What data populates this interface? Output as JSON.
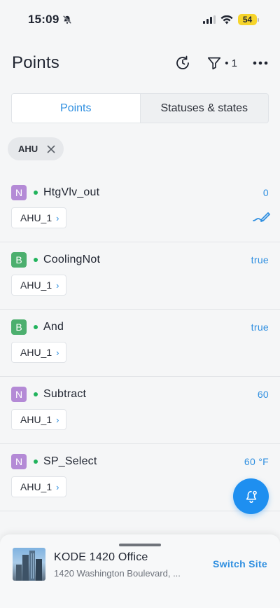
{
  "status_bar": {
    "time": "15:09",
    "battery": "54"
  },
  "header": {
    "title": "Points",
    "filter_count": "• 1"
  },
  "tabs": [
    {
      "label": "Points",
      "active": true
    },
    {
      "label": "Statuses & states",
      "active": false
    }
  ],
  "filter_chip": {
    "label": "AHU"
  },
  "points": [
    {
      "type": "N",
      "type_color": "#b48ad6",
      "name": "HtgVlv_out",
      "value": "0",
      "equipment": "AHU_1",
      "editable": true
    },
    {
      "type": "B",
      "type_color": "#4caf6e",
      "name": "CoolingNot",
      "value": "true",
      "equipment": "AHU_1",
      "editable": false
    },
    {
      "type": "B",
      "type_color": "#4caf6e",
      "name": "And",
      "value": "true",
      "equipment": "AHU_1",
      "editable": false
    },
    {
      "type": "N",
      "type_color": "#b48ad6",
      "name": "Subtract",
      "value": "60",
      "equipment": "AHU_1",
      "editable": false
    },
    {
      "type": "N",
      "type_color": "#b48ad6",
      "name": "SP_Select",
      "value": "60 °F",
      "equipment": "AHU_1",
      "editable": false
    }
  ],
  "site": {
    "name": "KODE 1420 Office",
    "address": "1420 Washington Boulevard, ...",
    "switch_label": "Switch Site"
  },
  "colors": {
    "accent": "#2f8fe0",
    "online_dot": "#21b35c",
    "fab": "#1e8ff0"
  },
  "icons": [
    "bell-off-icon",
    "signal-icon",
    "wifi-icon",
    "battery-icon",
    "refresh-icon",
    "filter-icon",
    "more-icon",
    "close-icon",
    "chevron-right-icon",
    "edit-icon",
    "alarm-bell-icon"
  ]
}
